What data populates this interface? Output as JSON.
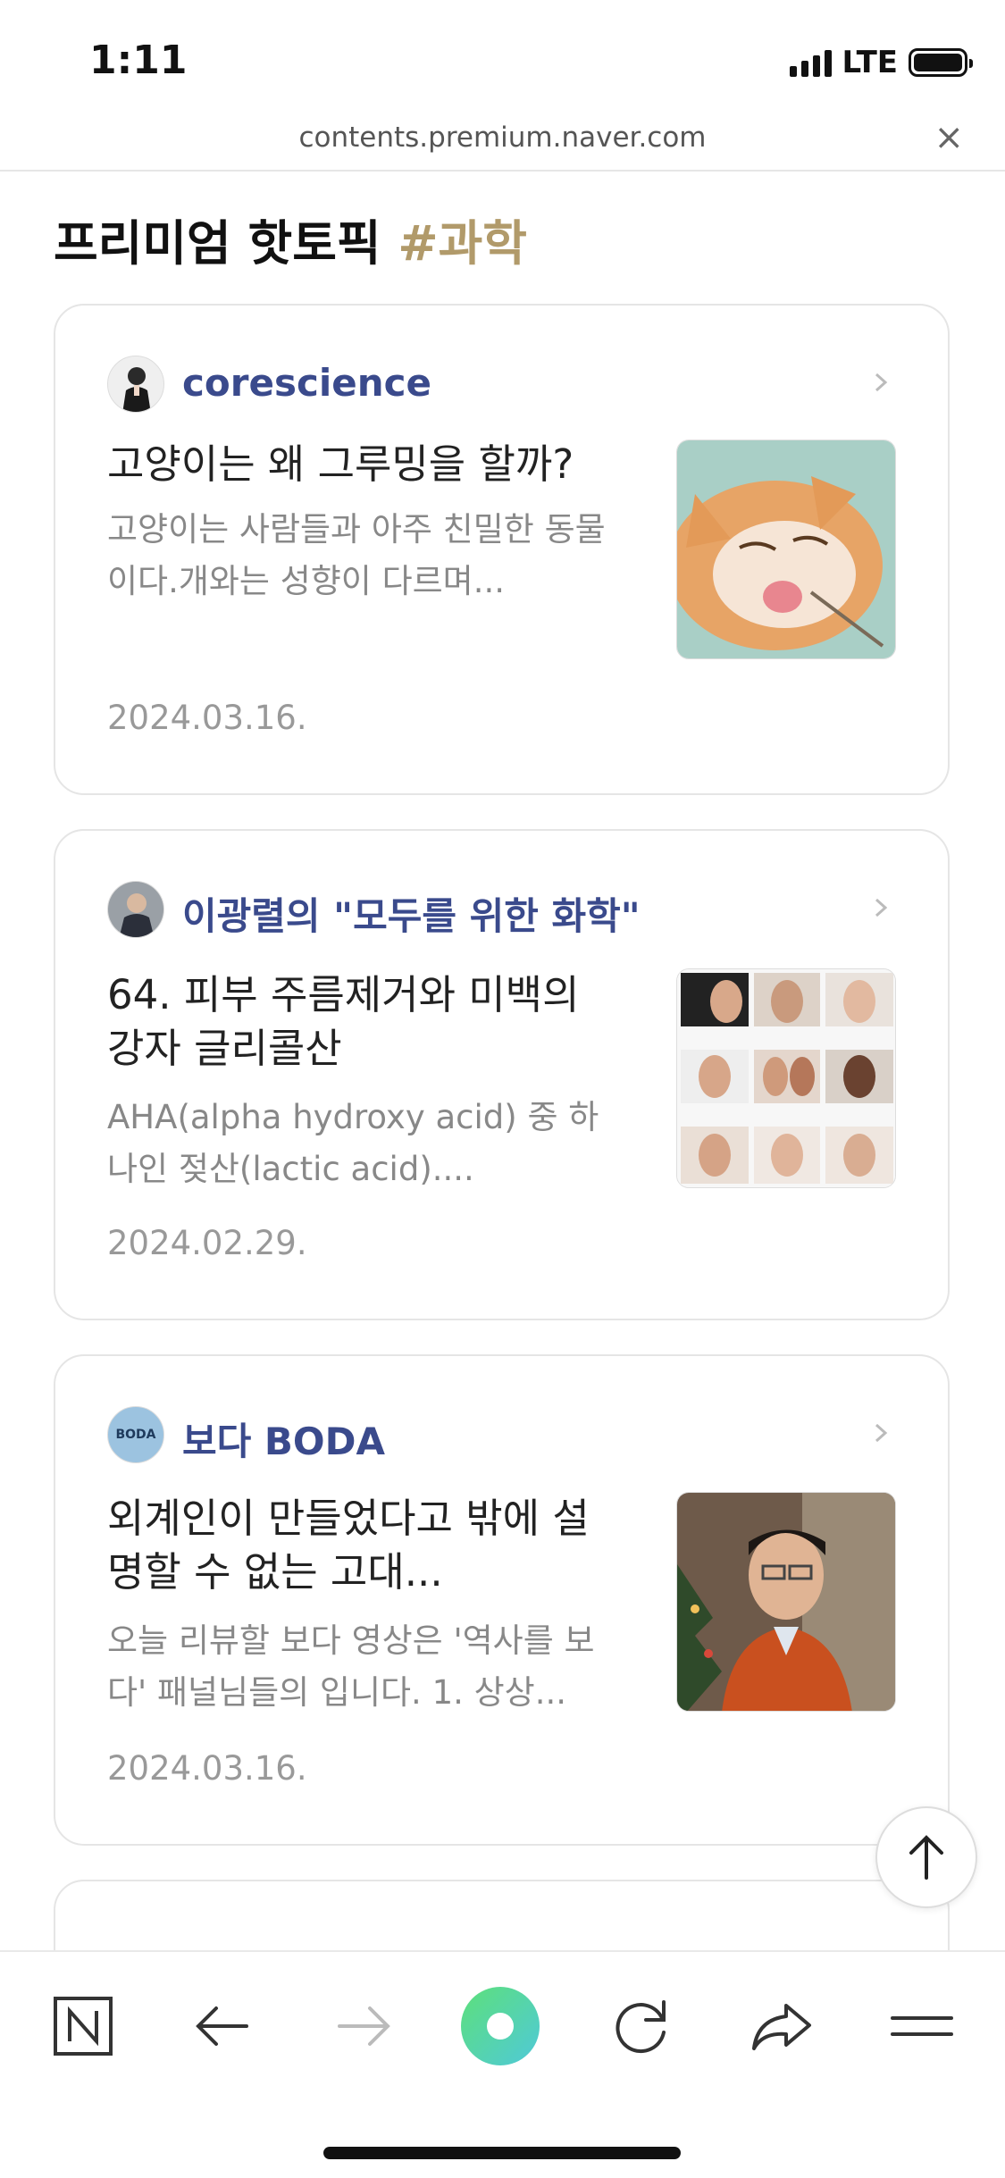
{
  "status_bar": {
    "time": "1:11",
    "network": "LTE"
  },
  "browser": {
    "url": "contents.premium.naver.com",
    "close_label": "×"
  },
  "page": {
    "title": "프리미엄 핫토픽",
    "hashtag": "#과학"
  },
  "cards": [
    {
      "author": "corescience",
      "title": "고양이는 왜 그루밍을 할까?",
      "excerpt": "고양이는 사람들과 아주 친밀한 동물이다.개와는 성향이 다르며...",
      "date": "2024.03.16.",
      "thumbnail": "cat-photo"
    },
    {
      "author": "이광렬의 \"모두를 위한 화학\"",
      "title": "64. 피부 주름제거와 미백의 강자 글리콜산",
      "excerpt": "AHA(alpha hydroxy acid) 중 하나인 젖산(lactic acid)....",
      "date": "2024.02.29.",
      "thumbnail": "skincare-collage"
    },
    {
      "author": "보다 BODA",
      "avatar_text": "BODA",
      "title": "외계인이 만들었다고 밖에 설명할 수 없는 고대...",
      "excerpt": "오늘 리뷰할 보다 영상은 '역사를 보다' 패널님들의 입니다. 1. 상상...",
      "date": "2024.03.16.",
      "thumbnail": "presenter-photo"
    }
  ],
  "colors": {
    "author": "#3a4a8c",
    "hashtag": "#b19a6a",
    "accent_green": "#4fd98a"
  },
  "toolbar": [
    "naver-home-icon",
    "back-arrow-icon",
    "forward-arrow-icon",
    "green-dot-icon",
    "reload-icon",
    "share-icon",
    "menu-icon"
  ]
}
